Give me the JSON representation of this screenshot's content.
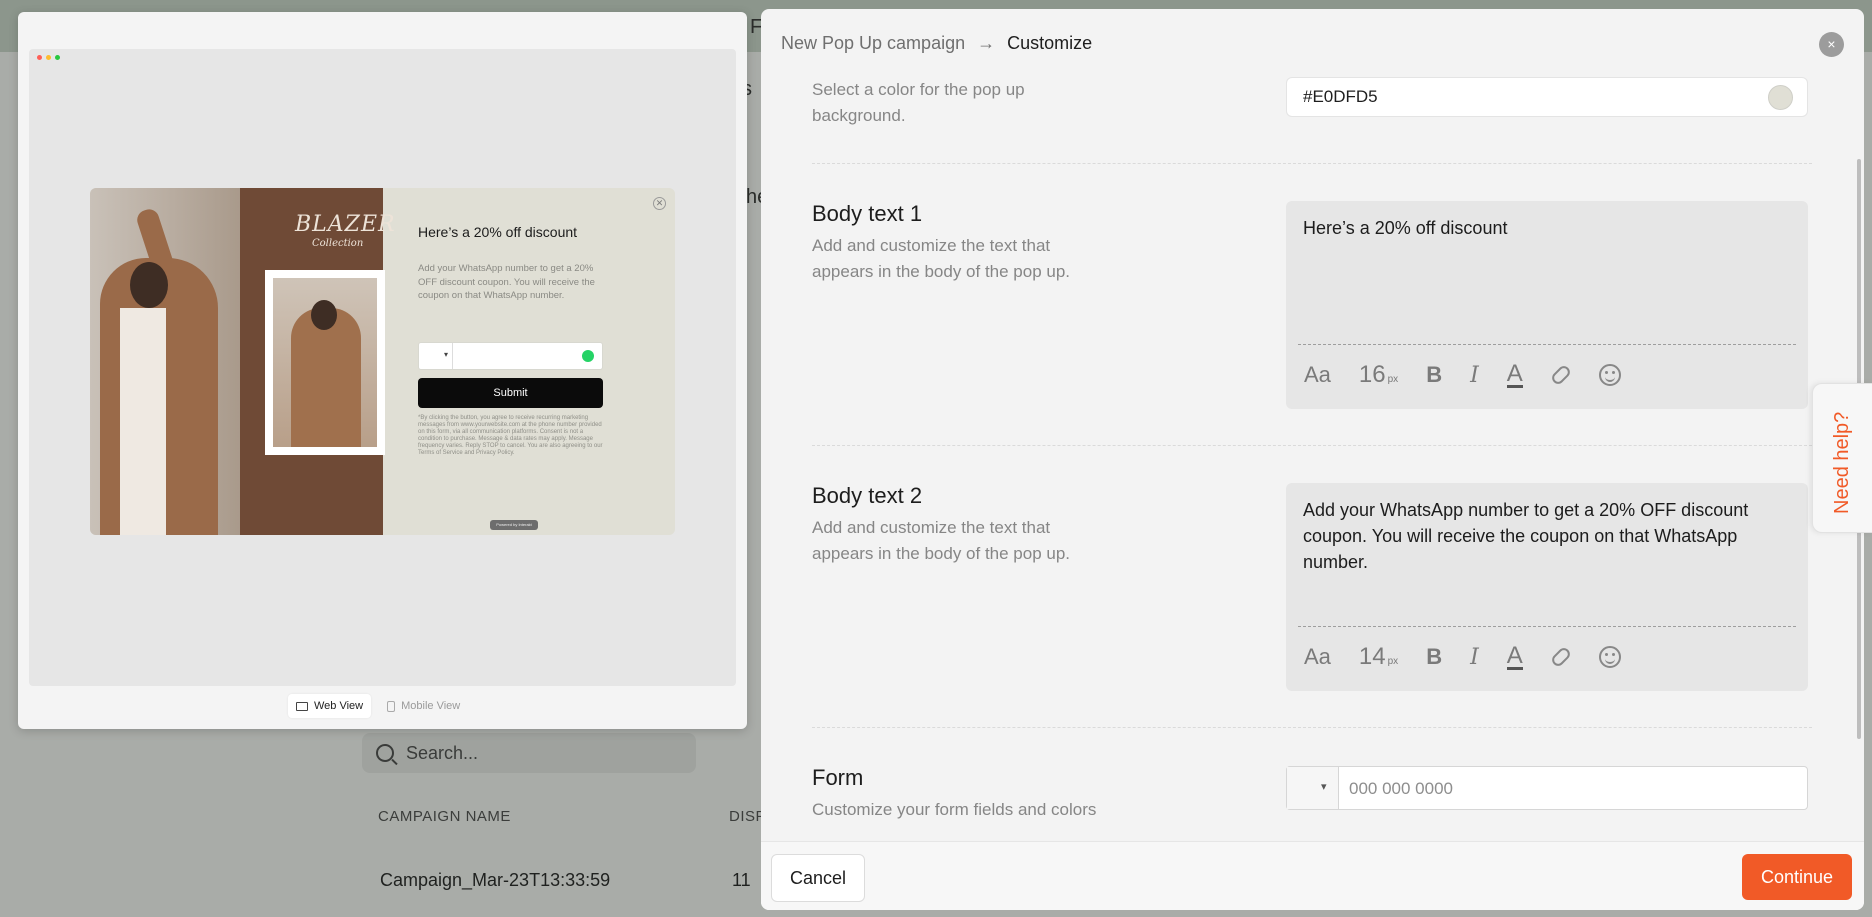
{
  "background": {
    "search_placeholder": "Search...",
    "columns": [
      "CAMPAIGN NAME",
      "DISP"
    ],
    "row": {
      "name": "Campaign_Mar-23T13:33:59",
      "value": "11"
    },
    "peek_letters": [
      "F",
      "s",
      "he"
    ]
  },
  "preview": {
    "popup": {
      "brand": "BLAZER",
      "brand_sub": "Collection",
      "headline": "Here’s a 20% off discount",
      "body": "Add your WhatsApp number to get a 20% OFF discount coupon. You will receive the coupon on that WhatsApp number.",
      "submit": "Submit",
      "fine_print": "*By clicking the button, you agree to receive recurring marketing messages from www.yourwebsite.com at the phone number provided on this form, via all communication platforms. Consent is not a condition to purchase. Message & data rates may apply. Message frequency varies. Reply STOP to cancel. You are also agreeing to our Terms of Service and Privacy Policy.",
      "powered": "Powered by Interakt",
      "close_icon": "close-icon"
    },
    "views": {
      "web": "Web View",
      "mobile": "Mobile View"
    },
    "dot_colors": [
      "#ff5f57",
      "#febc2e",
      "#28c840"
    ]
  },
  "panel": {
    "breadcrumb": {
      "step1": "New Pop Up campaign",
      "arrow": "→",
      "step2": "Customize"
    },
    "close": "×",
    "bg_color": {
      "desc": "Select a color for the pop up background.",
      "value": "#E0DFD5"
    },
    "body_text_1": {
      "title": "Body text 1",
      "desc": "Add and customize the text that appears in the body of the pop up.",
      "value": "Here’s a 20% off discount",
      "toolbar": {
        "aa": "Aa",
        "size": "16",
        "unit": "px",
        "bold": "B",
        "italic": "I",
        "color": "A"
      }
    },
    "body_text_2": {
      "title": "Body text 2",
      "desc": "Add and customize the text that appears in the body of the pop up.",
      "value": "Add your WhatsApp number to get a 20% OFF discount coupon. You will receive the coupon on that WhatsApp number.",
      "toolbar": {
        "aa": "Aa",
        "size": "14",
        "unit": "px",
        "bold": "B",
        "italic": "I",
        "color": "A"
      }
    },
    "form": {
      "title": "Form",
      "desc": "Customize your form fields and colors",
      "phone_placeholder": "000 000 0000"
    },
    "footer": {
      "cancel": "Cancel",
      "continue": "Continue"
    }
  },
  "need_help": "Need help?",
  "colors": {
    "accent": "#F15A27",
    "popup_bg": "#E0DFD5"
  }
}
